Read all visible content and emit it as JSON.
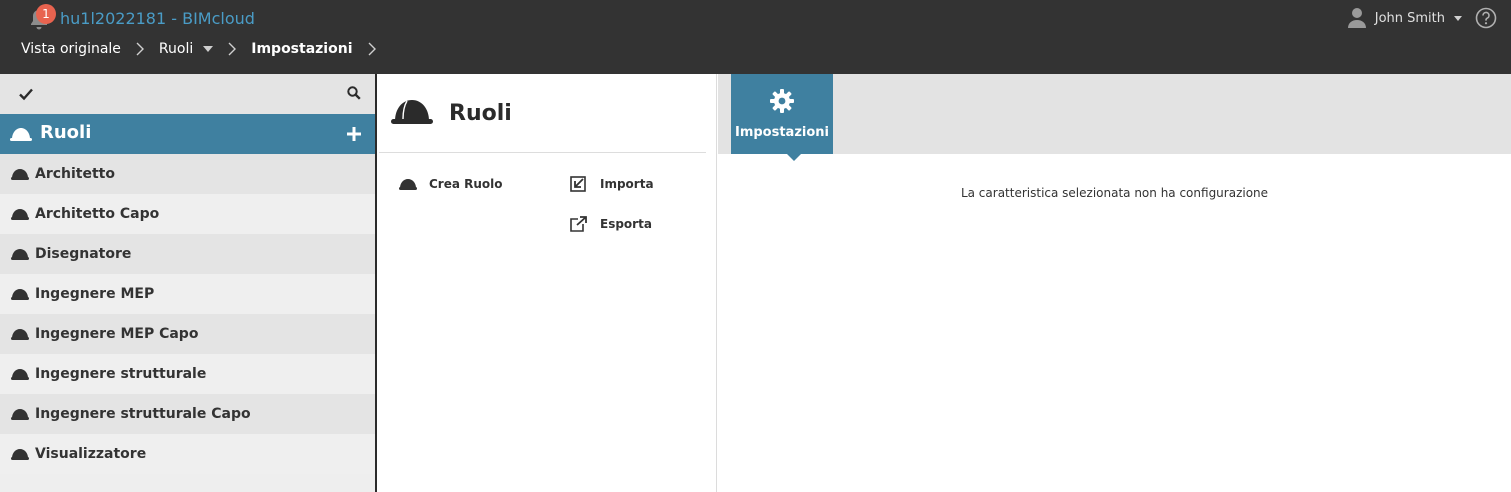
{
  "header": {
    "notification_count": "1",
    "server_name": "hu1l2022181 - BIMcloud",
    "user_name": "John Smith"
  },
  "breadcrumb": {
    "items": [
      "Vista originale",
      "Ruoli",
      "Impostazioni"
    ]
  },
  "sidebar": {
    "title": "Ruoli",
    "items": [
      {
        "label": "Architetto"
      },
      {
        "label": "Architetto Capo"
      },
      {
        "label": "Disegnatore"
      },
      {
        "label": "Ingegnere MEP"
      },
      {
        "label": "Ingegnere MEP Capo"
      },
      {
        "label": "Ingegnere strutturale"
      },
      {
        "label": "Ingegnere strutturale Capo"
      },
      {
        "label": "Visualizzatore"
      }
    ]
  },
  "middle": {
    "title": "Ruoli",
    "actions": {
      "create": "Crea Ruolo",
      "import": "Importa",
      "export": "Esporta"
    }
  },
  "right": {
    "tab_label": "Impostazioni",
    "empty_message": "La caratteristica selezionata non ha configurazione"
  },
  "colors": {
    "topbar": "#333333",
    "accent": "#3f80a0",
    "server_link": "#4a9cc6",
    "badge": "#e8634f"
  }
}
